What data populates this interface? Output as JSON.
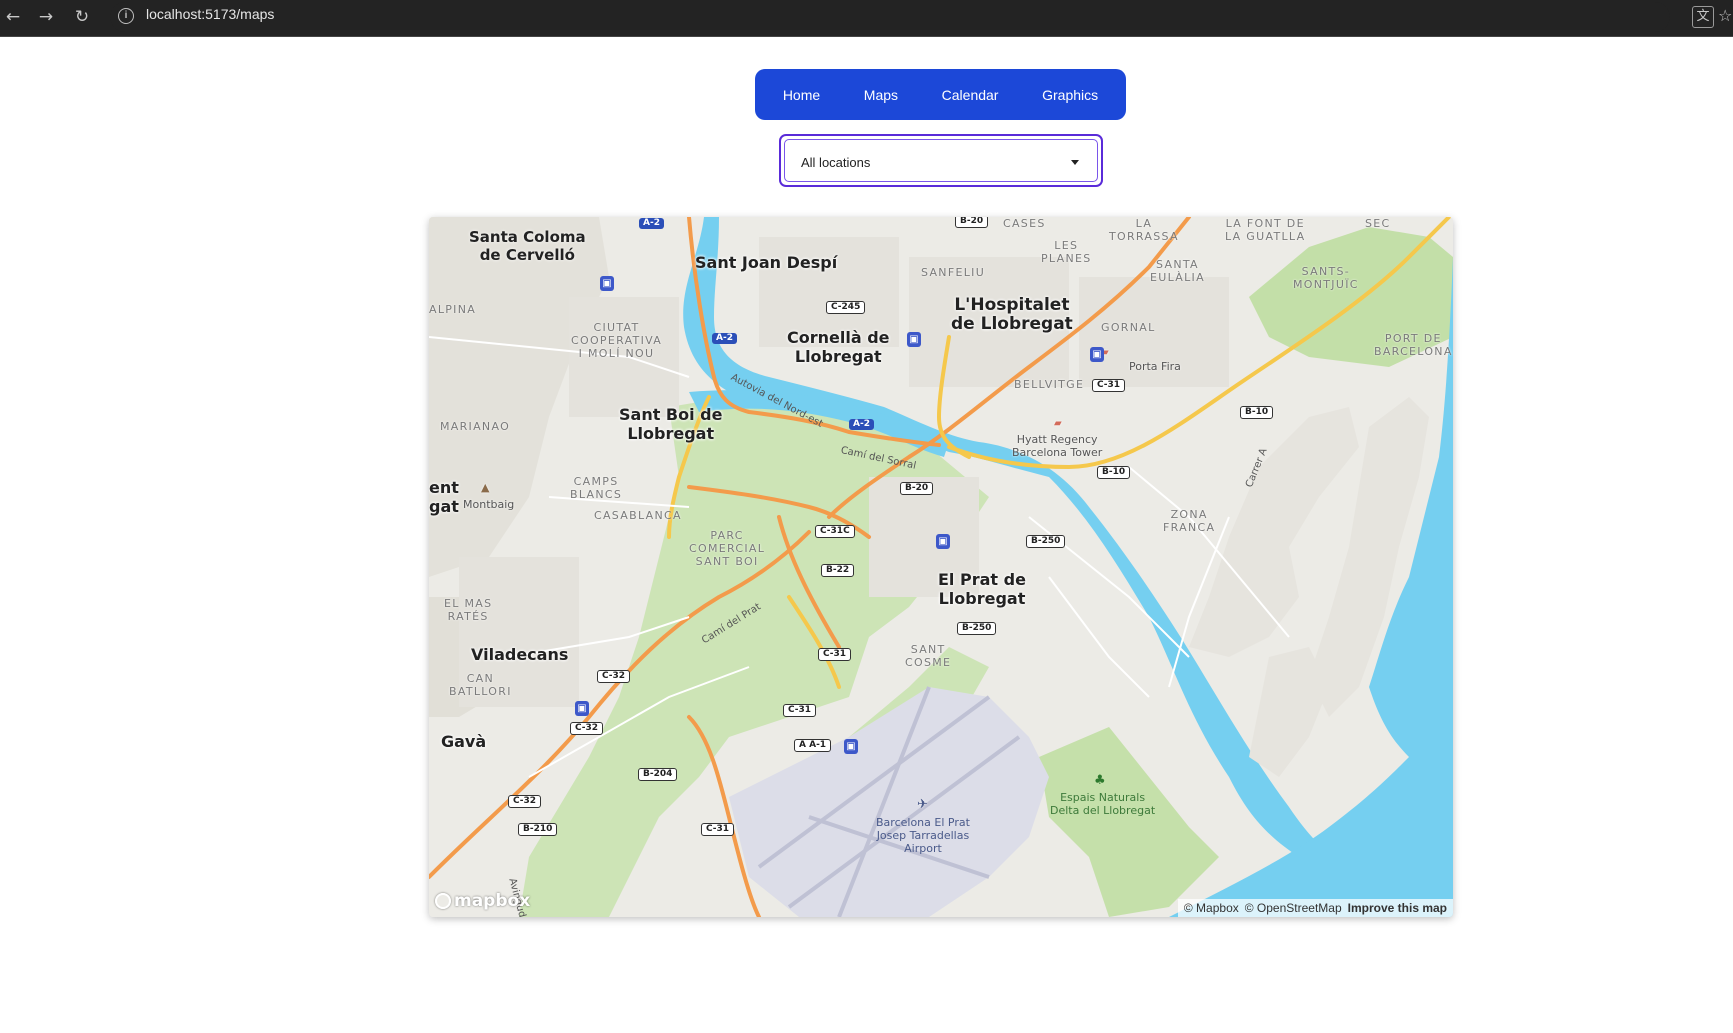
{
  "browser": {
    "url": "localhost:5173/maps",
    "icons": [
      "back-arrow-icon",
      "forward-arrow-icon",
      "reload-icon",
      "site-info-icon",
      "translate-icon",
      "bookmark-star-icon"
    ]
  },
  "nav": {
    "items": [
      {
        "label": "Home"
      },
      {
        "label": "Maps"
      },
      {
        "label": "Calendar"
      },
      {
        "label": "Graphics"
      }
    ]
  },
  "location_select": {
    "value": "All locations"
  },
  "map": {
    "cities": {
      "santa_coloma": "Santa Coloma\nde Cervelló",
      "sant_joan": "Sant Joan Despí",
      "cornella": "Cornellà de\nLlobregat",
      "hospitalet": "L'Hospitalet\nde Llobregat",
      "sant_boi": "Sant Boi de\nLlobregat",
      "el_prat": "El Prat de\nLlobregat",
      "viladecans": "Viladecans",
      "gava": "Gavà",
      "left_edge": "ent\ngat"
    },
    "districts": {
      "cases": "CASES",
      "la_torrassa": "LA\nTORRASSA",
      "la_font": "LA FONT DE\nLA GUATLLA",
      "sec": "SEC",
      "les_planes": "LES\nPLANES",
      "sanfeliu": "SANFELIU",
      "santa_eulalia": "SANTA\nEULÀLIA",
      "sants_montjuic": "SANTS-\nMONTJUÏC",
      "alpina": "ALPINA",
      "ciutat_coop": "CIUTAT\nCOOPERATIVA\nI MOLÍ NOU",
      "gornal": "GORNAL",
      "port_bcn": "PORT DE\nBARCELONA",
      "bellvitge": "BELLVITGE",
      "marianao": "MARIANAO",
      "camps_blancs": "CAMPS\nBLANCS",
      "casablanca": "CASABLANCA",
      "zona_franca": "ZONA\nFRANCA",
      "parc_comercial": "PARC\nCOMERCIAL\nSANT BOI",
      "el_mas_rates": "EL MAS\nRATÉS",
      "sant_cosme": "SANT\nCOSME",
      "can_batllori": "CAN\nBATLLORI"
    },
    "pois": {
      "porta_fira": "Porta Fira",
      "hyatt": "Hyatt Regency\nBarcelona Tower",
      "montbaig": "Montbaig",
      "airport": "Barcelona El Prat\nJosep Tarradellas\nAirport",
      "espais": "Espais Naturals\nDelta del Llobregat"
    },
    "streets": {
      "autovia": "Autovia del Nord-est",
      "cami_sorral": "Camí del Sorral",
      "cami_prat": "Camí del Prat",
      "carrer_a": "Carrer A",
      "avinguda": "Avingud"
    },
    "shields": {
      "a2_top": "A-2",
      "a2_mid": "A-2",
      "a2_bot": "A-2",
      "b20_top": "B-20",
      "c245": "C-245",
      "c31_top": "C-31",
      "b10_a": "B-10",
      "b10_b": "B-10",
      "b20_mid": "B-20",
      "c31c": "C-31C",
      "b250_a": "B-250",
      "b22": "B-22",
      "b250_b": "B-250",
      "c31_a": "C-31",
      "c32_a": "C-32",
      "c31_b": "C-31",
      "c32_b": "C-32",
      "aa1": "A A-1",
      "b204": "B-204",
      "c32_c": "C-32",
      "c31_c": "C-31",
      "b210": "B-210"
    },
    "logo": "mapbox",
    "attribution": {
      "mapbox": "© Mapbox",
      "osm": "© OpenStreetMap",
      "improve": "Improve this map"
    }
  },
  "colors": {
    "nav_bg": "#1c48d8",
    "select_border": "#5a2bd9",
    "water": "#75cff0",
    "motorway": "#f39b4b",
    "trunk": "#f5c84c",
    "park": "#c8e2b0"
  }
}
